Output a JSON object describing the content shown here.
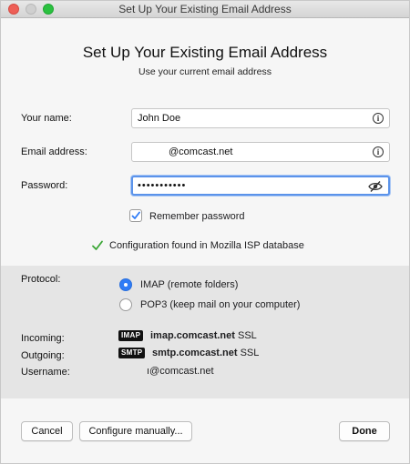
{
  "window": {
    "title": "Set Up Your Existing Email Address"
  },
  "header": {
    "title": "Set Up Your Existing Email Address",
    "subtitle": "Use your current email address"
  },
  "form": {
    "name_label": "Your name:",
    "name_value": "John Doe",
    "email_label": "Email address:",
    "email_value": "@comcast.net",
    "password_label": "Password:",
    "password_value": "•••••••••••",
    "remember_label": "Remember password",
    "remember_checked": true
  },
  "status": {
    "config_found": "Configuration found in Mozilla ISP database"
  },
  "protocol": {
    "label": "Protocol:",
    "options": [
      {
        "label": "IMAP (remote folders)",
        "selected": true
      },
      {
        "label": "POP3 (keep mail on your computer)",
        "selected": false
      }
    ]
  },
  "servers": {
    "incoming_label": "Incoming:",
    "incoming_badge": "IMAP",
    "incoming_host": "imap.comcast.net",
    "incoming_security": "SSL",
    "outgoing_label": "Outgoing:",
    "outgoing_badge": "SMTP",
    "outgoing_host": "smtp.comcast.net",
    "outgoing_security": "SSL",
    "username_label": "Username:",
    "username_value": "ı@comcast.net"
  },
  "buttons": {
    "cancel": "Cancel",
    "configure_manually": "Configure manually...",
    "done": "Done"
  },
  "colors": {
    "accent": "#2f7cf6",
    "check_green": "#3aa635",
    "close": "#ee5f57",
    "maximize": "#2bc140"
  }
}
